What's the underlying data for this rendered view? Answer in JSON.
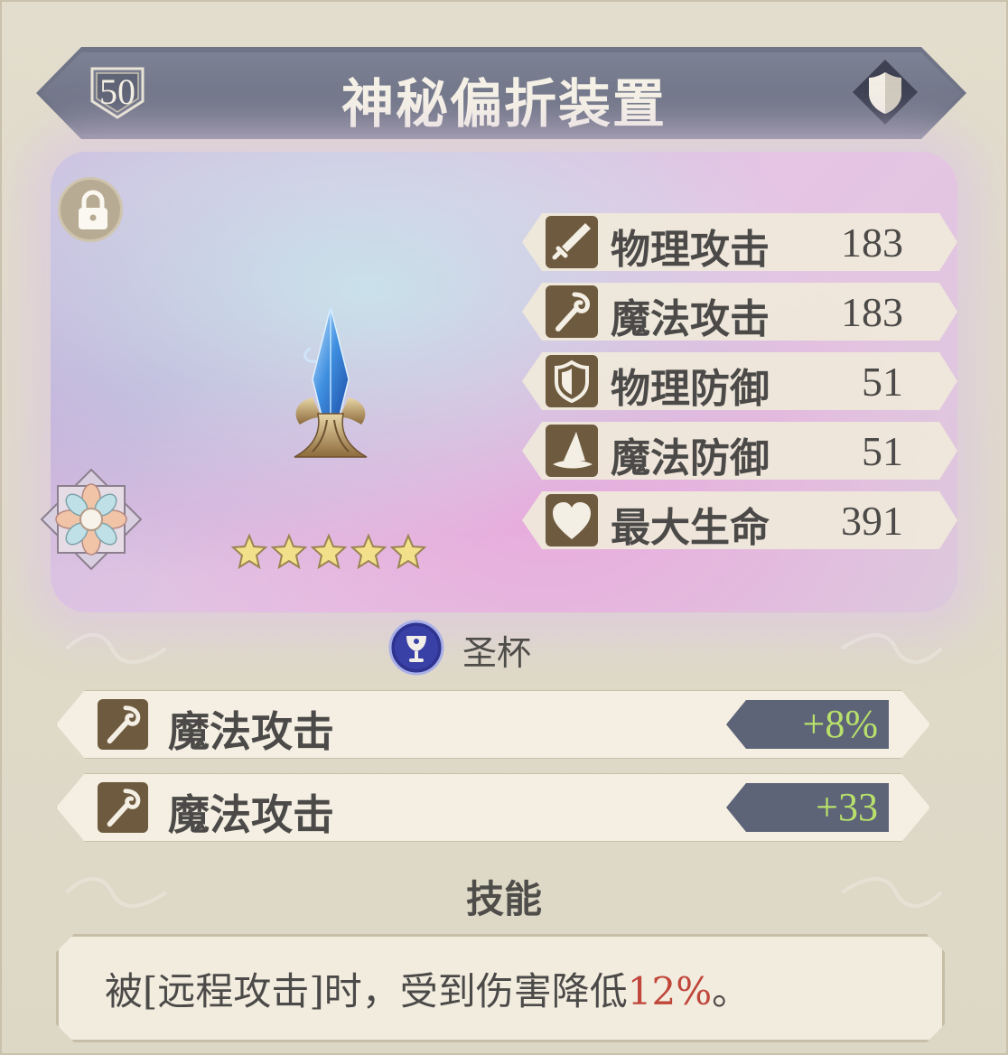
{
  "header": {
    "level": "50",
    "title": "神秘偏折装置"
  },
  "icons": {
    "level": "shield-badge-icon",
    "type": "shield-icon",
    "lock": "lock-icon",
    "emblem": "flower-emblem-icon",
    "set": "holy-grail-icon"
  },
  "rarity": {
    "stars": 5,
    "max": 5
  },
  "stats": [
    {
      "name": "物理攻击",
      "value": "183",
      "icon": "sword-icon"
    },
    {
      "name": "魔法攻击",
      "value": "183",
      "icon": "staff-icon"
    },
    {
      "name": "物理防御",
      "value": "51",
      "icon": "shield-icon"
    },
    {
      "name": "魔法防御",
      "value": "51",
      "icon": "wizard-hat-icon"
    },
    {
      "name": "最大生命",
      "value": "391",
      "icon": "heart-icon"
    }
  ],
  "set": {
    "name": "圣杯"
  },
  "sub_stats": [
    {
      "name": "魔法攻击",
      "value": "+8%",
      "icon": "staff-icon"
    },
    {
      "name": "魔法攻击",
      "value": "+33",
      "icon": "staff-icon"
    }
  ],
  "skill": {
    "title": "技能",
    "text_before": "被[远程攻击]时，受到伤害降低",
    "highlight": "12%",
    "text_after": "。"
  },
  "colors": {
    "banner": "#6f7486",
    "icon_bg": "#6e5a3e",
    "bonus_text": "#b8e06b",
    "highlight": "#c0463a"
  }
}
